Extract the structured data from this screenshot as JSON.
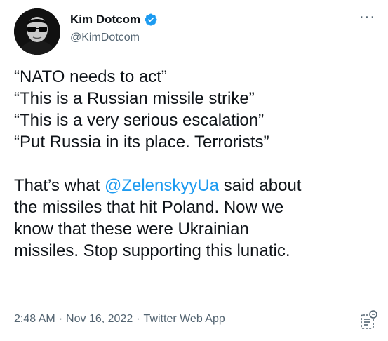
{
  "author": {
    "display_name": "Kim Dotcom",
    "handle": "@KimDotcom",
    "verified": true
  },
  "tweet": {
    "quote_lines": [
      "“NATO needs to act”",
      "“This is a Russian missile strike”",
      "“This is a very serious escalation”",
      "“Put Russia in its place. Terrorists”"
    ],
    "para_prefix": "That’s what ",
    "mention": "@ZelenskyyUa",
    "para_lines": [
      " said about",
      "the missiles that hit Poland. Now we",
      "know that these were Ukrainian",
      "missiles. Stop supporting this lunatic."
    ]
  },
  "meta": {
    "time": "2:48 AM",
    "separator": "·",
    "date": "Nov 16, 2022",
    "source": "Twitter Web App"
  },
  "colors": {
    "link": "#1d9bf0",
    "secondary_text": "#536471",
    "primary_text": "#0f1419",
    "verified_badge": "#1d9bf0"
  },
  "icons": {
    "more": "more-dots-icon",
    "verified": "verified-badge-icon",
    "analytics": "tweet-analytics-icon"
  }
}
